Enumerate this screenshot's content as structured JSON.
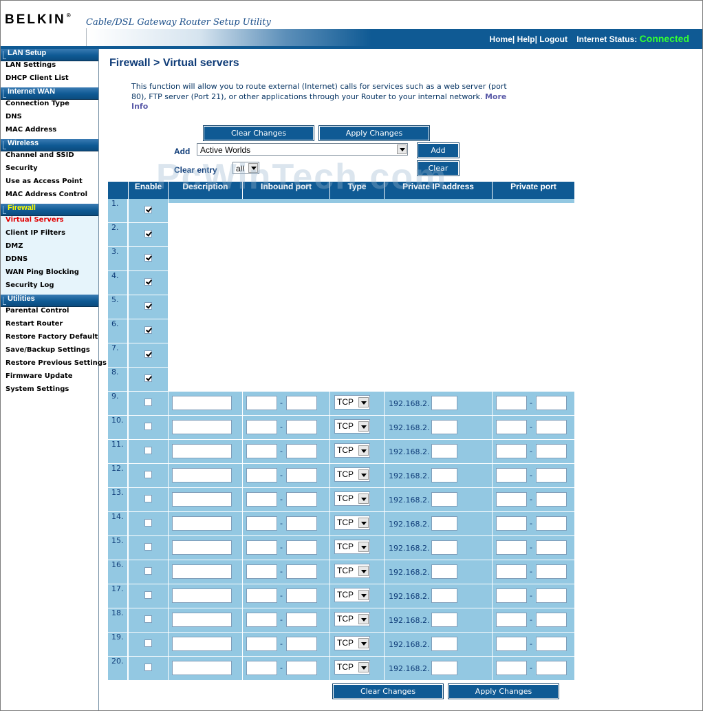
{
  "header": {
    "brand": "BELKIN",
    "brand_mark": "®",
    "subtitle": "Cable/DSL Gateway Router Setup Utility",
    "nav": {
      "home": "Home",
      "help": "Help",
      "logout": "Logout",
      "sep": "|"
    },
    "status_label": "Internet Status:",
    "status_value": "Connected"
  },
  "sidebar": {
    "groups": [
      {
        "title": "LAN Setup",
        "items": [
          "LAN Settings",
          "DHCP Client List"
        ]
      },
      {
        "title": "Internet WAN",
        "items": [
          "Connection Type",
          "DNS",
          "MAC Address"
        ]
      },
      {
        "title": "Wireless",
        "items": [
          "Channel and SSID",
          "Security",
          "Use as Access Point",
          "MAC Address Control"
        ]
      },
      {
        "title": "Firewall",
        "active": true,
        "items": [
          "Virtual Servers",
          "Client IP Filters",
          "DMZ",
          "DDNS",
          "WAN Ping Blocking",
          "Security Log"
        ],
        "current": "Virtual Servers"
      },
      {
        "title": "Utilities",
        "items": [
          "Parental Control",
          "Restart Router",
          "Restore Factory Default",
          "Save/Backup Settings",
          "Restore Previous Settings",
          "Firmware Update",
          "System Settings"
        ]
      }
    ]
  },
  "main": {
    "title": "Firewall > Virtual servers",
    "description": "This function will allow you to route external (Internet) calls for services such as a web server (port 80), FTP server (Port 21), or other applications through your Router to your internal network.",
    "more_info": "More Info",
    "clear_changes": "Clear Changes",
    "apply_changes": "Apply Changes",
    "add_label": "Add",
    "add_select_value": "Active Worlds",
    "add_button": "Add",
    "clear_entry_label": "Clear entry",
    "clear_entry_value": "all",
    "clear_button": "Clear",
    "watermark": "PcWinTech.com"
  },
  "table": {
    "columns": [
      "Enable",
      "Description",
      "Inbound port",
      "Type",
      "Private IP address",
      "Private port"
    ],
    "ip_prefix": "192.168.2.",
    "type_default": "TCP",
    "port_dash": "-",
    "rows": [
      {
        "n": "1.",
        "enabled": true,
        "filled": true
      },
      {
        "n": "2.",
        "enabled": true,
        "filled": true
      },
      {
        "n": "3.",
        "enabled": true,
        "filled": true
      },
      {
        "n": "4.",
        "enabled": true,
        "filled": true
      },
      {
        "n": "5.",
        "enabled": true,
        "filled": true
      },
      {
        "n": "6.",
        "enabled": true,
        "filled": true
      },
      {
        "n": "7.",
        "enabled": true,
        "filled": true
      },
      {
        "n": "8.",
        "enabled": true,
        "filled": true
      },
      {
        "n": "9.",
        "enabled": false,
        "filled": false
      },
      {
        "n": "10.",
        "enabled": false,
        "filled": false
      },
      {
        "n": "11.",
        "enabled": false,
        "filled": false
      },
      {
        "n": "12.",
        "enabled": false,
        "filled": false
      },
      {
        "n": "13.",
        "enabled": false,
        "filled": false
      },
      {
        "n": "14.",
        "enabled": false,
        "filled": false
      },
      {
        "n": "15.",
        "enabled": false,
        "filled": false
      },
      {
        "n": "16.",
        "enabled": false,
        "filled": false
      },
      {
        "n": "17.",
        "enabled": false,
        "filled": false
      },
      {
        "n": "18.",
        "enabled": false,
        "filled": false
      },
      {
        "n": "19.",
        "enabled": false,
        "filled": false
      },
      {
        "n": "20.",
        "enabled": false,
        "filled": false
      }
    ]
  },
  "colors": {
    "brand_blue": "#0f5a94",
    "row_bg": "#93c8e2",
    "status_green": "#33ff33",
    "current_item": "#e00000",
    "active_group": "#ffff00"
  }
}
